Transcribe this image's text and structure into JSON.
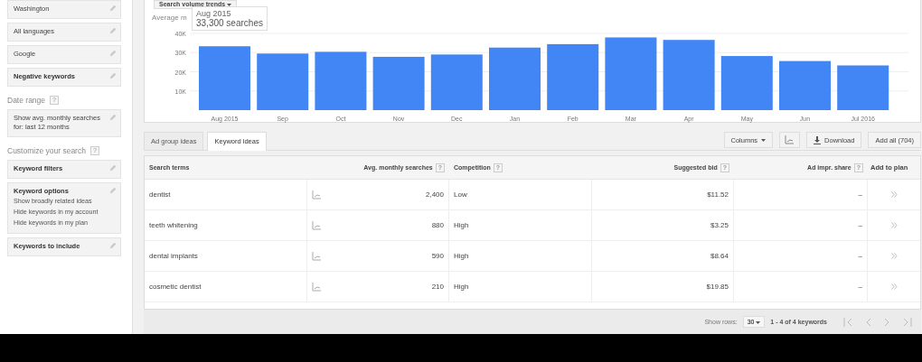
{
  "sidebar": {
    "sections": [
      {
        "cards": [
          {
            "kind": "value",
            "title": "Washington"
          },
          {
            "kind": "value",
            "title": "All languages"
          },
          {
            "kind": "value",
            "title": "Google"
          },
          {
            "kind": "group",
            "title": "Negative keywords"
          }
        ]
      },
      {
        "heading": {
          "text": "Date range",
          "help": "?"
        },
        "cards": [
          {
            "kind": "value",
            "title": "Show avg. monthly searches for: last 12 months"
          }
        ]
      },
      {
        "heading": {
          "text": "Customize your search",
          "help": "?"
        },
        "cards": [
          {
            "kind": "group",
            "title": "Keyword filters"
          },
          {
            "kind": "group",
            "title": "Keyword options",
            "lines": [
              "Show broadly related ideas",
              "Hide keywords in my account",
              "Hide keywords in my plan"
            ]
          },
          {
            "kind": "group",
            "title": "Keywords to include"
          }
        ]
      }
    ]
  },
  "chart_panel": {
    "view_button": "Search volume trends",
    "caption": "Average m",
    "tooltip": {
      "title": "Aug 2015",
      "text": "33,300 searches"
    },
    "chart_data": {
      "type": "bar",
      "grid": true,
      "categories": [
        "Aug 2015",
        "Sep",
        "Oct",
        "Nov",
        "Dec",
        "Jan",
        "Feb",
        "Mar",
        "Apr",
        "May",
        "Jun",
        "Jul 2016"
      ],
      "series": [
        {
          "color": "#4285f4",
          "values": [
            33300,
            29500,
            30400,
            27800,
            29000,
            32600,
            34400,
            37900,
            36600,
            28200,
            25600,
            23300
          ]
        }
      ],
      "ylim": [
        0,
        40000
      ],
      "yticks": [
        {
          "value": 10000,
          "label": "10K"
        },
        {
          "value": 20000,
          "label": "20K"
        },
        {
          "value": 30000,
          "label": "30K"
        },
        {
          "value": 40000,
          "label": "40K"
        }
      ]
    }
  },
  "tabs": [
    {
      "label": "Ad group ideas",
      "selected": false
    },
    {
      "label": "Keyword ideas",
      "selected": true
    }
  ],
  "toolbar": {
    "columns": "Columns",
    "download": "Download",
    "add_all": "Add all (704)"
  },
  "table": {
    "columns": [
      {
        "label": "Search terms"
      },
      {
        "label": "Avg. monthly searches",
        "help": "?"
      },
      {
        "label": "Competition",
        "help": "?"
      },
      {
        "label": "Suggested bid",
        "help": "?"
      },
      {
        "label": "Ad impr. share",
        "help": "?"
      },
      {
        "label": "Add to plan"
      }
    ],
    "rows": [
      {
        "term": "dentist",
        "searches": "2,400",
        "competition": "Low",
        "bid": "$11.52",
        "share": "–"
      },
      {
        "term": "teeth whitening",
        "searches": "880",
        "competition": "High",
        "bid": "$3.25",
        "share": "–"
      },
      {
        "term": "dental implants",
        "searches": "590",
        "competition": "High",
        "bid": "$8.64",
        "share": "–"
      },
      {
        "term": "cosmetic dentist",
        "searches": "210",
        "competition": "High",
        "bid": "$19.85",
        "share": "–"
      }
    ]
  },
  "pager": {
    "show_rows_label": "Show rows:",
    "rows_value": "30",
    "range": "1 - 4 of 4 keywords"
  }
}
